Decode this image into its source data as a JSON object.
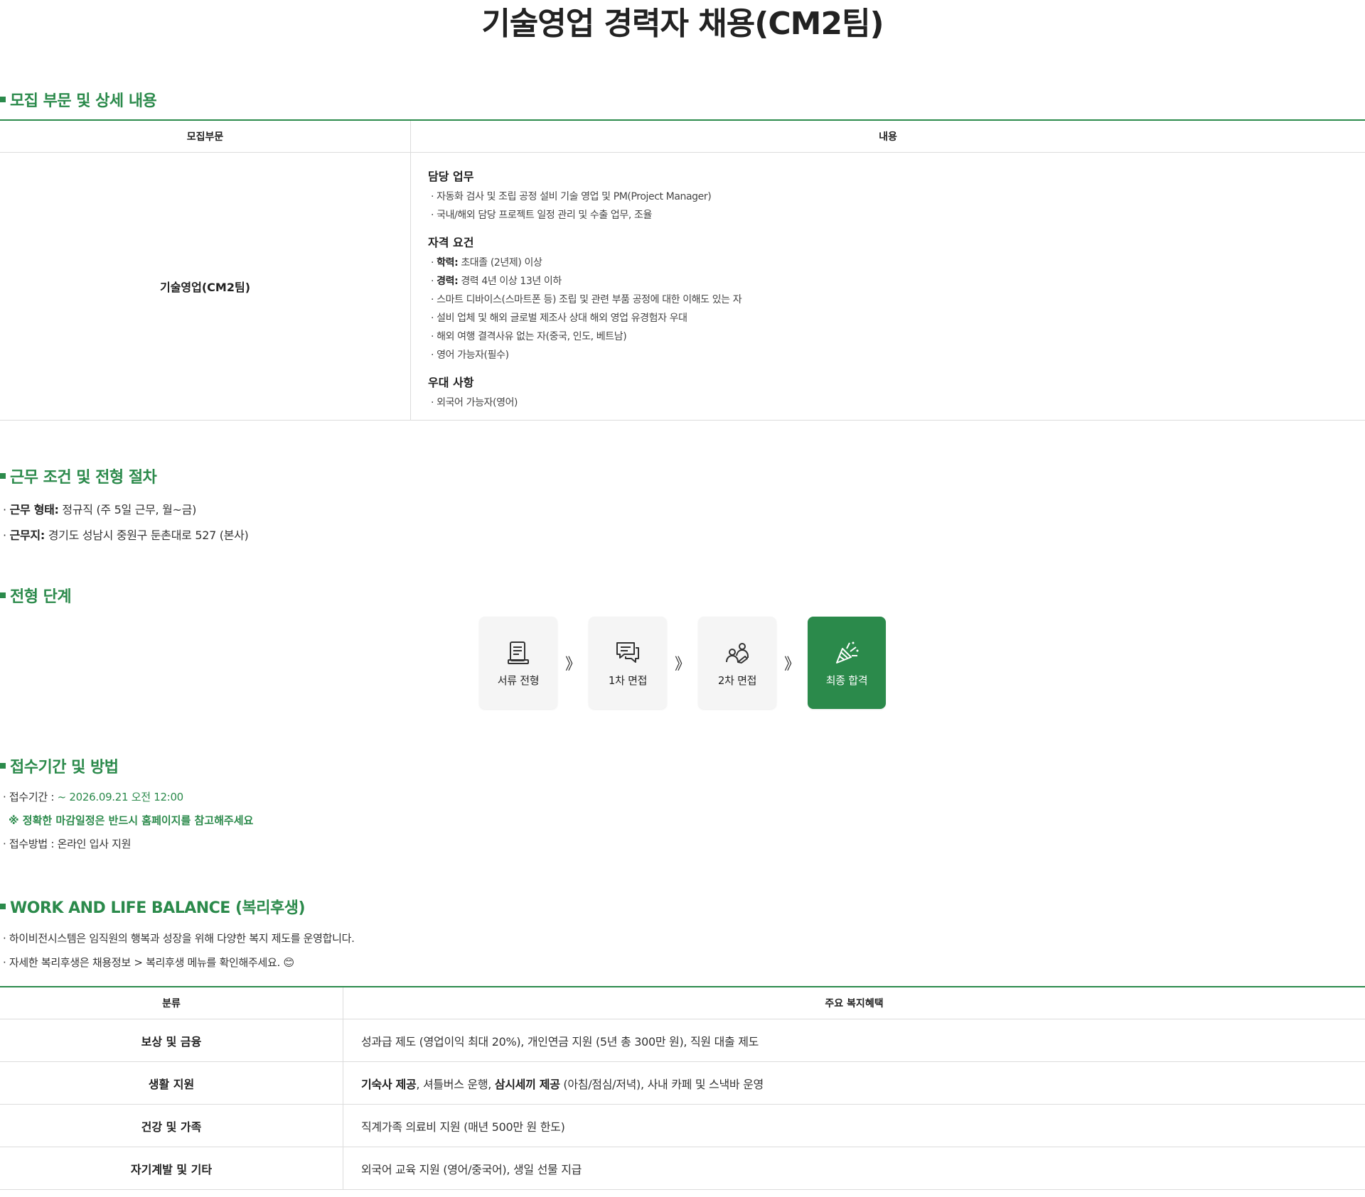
{
  "title": "기술영업 경력자 채용(CM2팀)",
  "sections": {
    "recruit": "모집 부문 및 상세 내용",
    "conditions": "근무 조건 및 전형 절차",
    "steps": "전형 단계",
    "apply": "접수기간 및 방법",
    "welfare": "WORK AND LIFE BALANCE (복리후생)"
  },
  "recruit_table": {
    "headers": [
      "모집부문",
      "내용"
    ],
    "dept": "기술영업(CM2팀)",
    "duties_title": "담당 업무",
    "duties": [
      "· 자동화 검사 및 조립 공정 설비 기술 영업 및 PM(Project Manager)",
      "· 국내/해외 담당 프로젝트 일정 관리 및 수출 업무, 조율"
    ],
    "req_title": "자격 요건",
    "req": [
      {
        "label": "학력:",
        "text": " 초대졸 (2년제) 이상"
      },
      {
        "label": "경력:",
        "text": " 경력 4년 이상 13년 이하"
      },
      {
        "label": "",
        "text": "스마트 디바이스(스마트폰 등) 조립 및 관련 부품 공정에 대한 이해도 있는 자"
      },
      {
        "label": "",
        "text": "설비 업체 및 해외 글로벌 제조사 상대 해외 영업 유경험자 우대"
      },
      {
        "label": "",
        "text": "해외 여행 결격사유 없는 자(중국, 인도, 베트남)"
      },
      {
        "label": "",
        "text": "영어 가능자(필수)"
      }
    ],
    "pref_title": "우대 사항",
    "pref": [
      "· 외국어 가능자(영어)"
    ]
  },
  "conditions": [
    {
      "label": "근무 형태:",
      "text": " 정규직 (주 5일 근무, 월~금)"
    },
    {
      "label": "근무지:",
      "text": " 경기도 성남시 중원구 둔촌대로 527 (본사)"
    }
  ],
  "steps": [
    {
      "label": "서류 전형",
      "icon": "document-icon",
      "active": false
    },
    {
      "label": "1차 면접",
      "icon": "chat-icon",
      "active": false
    },
    {
      "label": "2차 면접",
      "icon": "people-icon",
      "active": false
    },
    {
      "label": "최종 합격",
      "icon": "party-popper-icon",
      "active": true
    }
  ],
  "step_arrow": "》",
  "apply": {
    "period_label": "· 접수기간 : ",
    "period_value": "~ 2026.09.21 오전 12:00",
    "note": "※ 정확한 마감일정은 반드시 홈페이지를 참고해주세요",
    "method": "· 접수방법 : 온라인 입사 지원"
  },
  "welfare_intro": [
    "· 하이비전시스템은 임직원의 행복과 성장을 위해 다양한 복지 제도를 운영합니다.",
    "· 자세한 복리후생은 채용정보 > 복리후생 메뉴를 확인해주세요. 😊"
  ],
  "welfare_table": {
    "headers": [
      "분류",
      "주요 복지혜택"
    ],
    "rows": [
      {
        "cat": "보상 및 금융",
        "b1": "",
        "t1": "성과급 제도 (영업이익 최대 20%), 개인연금 지원 (5년 총 300만 원), 직원 대출 제도",
        "b2": "",
        "t2": ""
      },
      {
        "cat": "생활 지원",
        "b1": "기숙사 제공",
        "t1": ", 셔틀버스 운행, ",
        "b2": "삼시세끼 제공",
        "t2": " (아침/점심/저녁), 사내 카페 및 스낵바 운영"
      },
      {
        "cat": "건강 및 가족",
        "b1": "",
        "t1": "직계가족 의료비 지원 (매년 500만 원 한도)",
        "b2": "",
        "t2": ""
      },
      {
        "cat": "자기계발 및 기타",
        "b1": "",
        "t1": "외국어 교육 지원 (영어/중국어), 생일 선물 지급",
        "b2": "",
        "t2": ""
      }
    ]
  },
  "colors": {
    "accent": "#2b8a4b",
    "border": "#dcdcdc",
    "step_bg": "#f5f5f5"
  }
}
